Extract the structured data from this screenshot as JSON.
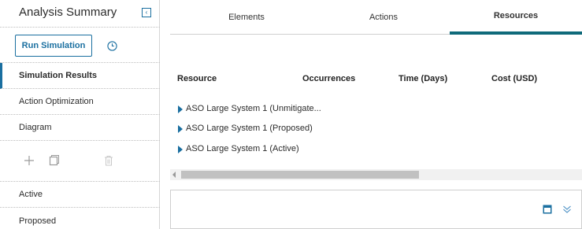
{
  "sidebar": {
    "title": "Analysis Summary",
    "collapse_glyph": "‹",
    "run_button": "Run Simulation",
    "items": [
      {
        "label": "Simulation Results",
        "active": true
      },
      {
        "label": "Action Optimization",
        "active": false
      },
      {
        "label": "Diagram",
        "active": false
      }
    ],
    "scenarios": [
      {
        "label": "Active"
      },
      {
        "label": "Proposed"
      }
    ],
    "action_icons": [
      "plus-icon",
      "copy-icon",
      "trash-icon"
    ]
  },
  "tabs": [
    {
      "label": "Elements",
      "selected": false
    },
    {
      "label": "Actions",
      "selected": false
    },
    {
      "label": "Resources",
      "selected": true
    }
  ],
  "table": {
    "columns": [
      "Resource",
      "Occurrences",
      "Time (Days)",
      "Cost (USD)"
    ],
    "rows": [
      {
        "label": "ASO Large System 1 (Unmitigate..."
      },
      {
        "label": "ASO Large System 1 (Proposed)"
      },
      {
        "label": "ASO Large System 1 (Active)"
      }
    ]
  },
  "bottom_panel": {
    "icons": [
      "window-icon",
      "double-chevron-down-icon"
    ]
  },
  "colors": {
    "accent": "#1a6fa0",
    "tab_indicator": "#0f6a7a"
  }
}
